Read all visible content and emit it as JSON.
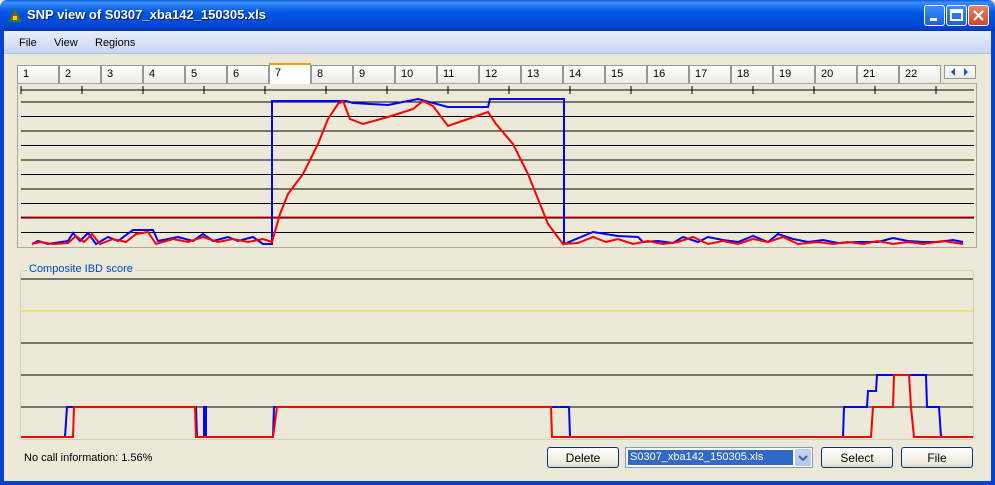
{
  "window": {
    "title": "SNP view of S0307_xba142_150305.xls"
  },
  "menu": {
    "items": [
      "File",
      "View",
      "Regions"
    ]
  },
  "chromosome_tabs": [
    "1",
    "2",
    "3",
    "4",
    "5",
    "6",
    "7",
    "8",
    "9",
    "10",
    "11",
    "12",
    "13",
    "14",
    "15",
    "16",
    "17",
    "18",
    "19",
    "20",
    "21",
    "22"
  ],
  "active_tab": "7",
  "composite": {
    "label": "Composite IBD score"
  },
  "status": {
    "no_call": "No call information: 1.56%"
  },
  "buttons": {
    "delete": "Delete",
    "select": "Select",
    "file": "File"
  },
  "file_combo": {
    "value": "S0307_xba142_150305.xls"
  },
  "colors": {
    "series_blue": "#0000ff",
    "series_red": "#ff0000",
    "threshold_line": "#ff0000",
    "composite_yellow": "#e8e000",
    "grid": "#000000"
  },
  "icons": [
    "app-icon",
    "minimize-icon",
    "maximize-icon",
    "close-icon",
    "scroll-left-icon",
    "scroll-right-icon",
    "dropdown-arrow-icon"
  ]
}
